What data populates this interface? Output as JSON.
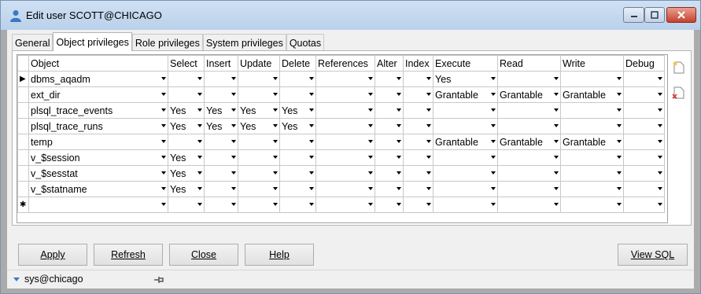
{
  "window": {
    "title": "Edit user SCOTT@CHICAGO",
    "controls": [
      "minimize",
      "maximize",
      "close"
    ]
  },
  "tabs": [
    {
      "label": "General",
      "active": false
    },
    {
      "label": "Object privileges",
      "active": true
    },
    {
      "label": "Role privileges",
      "active": false
    },
    {
      "label": "System privileges",
      "active": false
    },
    {
      "label": "Quotas",
      "active": false
    }
  ],
  "grid": {
    "columns": [
      "Object",
      "Select",
      "Insert",
      "Update",
      "Delete",
      "References",
      "Alter",
      "Index",
      "Execute",
      "Read",
      "Write",
      "Debug"
    ],
    "rows": [
      [
        "dbms_aqadm",
        "",
        "",
        "",
        "",
        "",
        "",
        "",
        "Yes",
        "",
        "",
        ""
      ],
      [
        "ext_dir",
        "",
        "",
        "",
        "",
        "",
        "",
        "",
        "Grantable",
        "Grantable",
        "Grantable",
        ""
      ],
      [
        "plsql_trace_events",
        "Yes",
        "Yes",
        "Yes",
        "Yes",
        "",
        "",
        "",
        "",
        "",
        "",
        ""
      ],
      [
        "plsql_trace_runs",
        "Yes",
        "Yes",
        "Yes",
        "Yes",
        "",
        "",
        "",
        "",
        "",
        "",
        ""
      ],
      [
        "temp",
        "",
        "",
        "",
        "",
        "",
        "",
        "",
        "Grantable",
        "Grantable",
        "Grantable",
        ""
      ],
      [
        "v_$session",
        "Yes",
        "",
        "",
        "",
        "",
        "",
        "",
        "",
        "",
        "",
        ""
      ],
      [
        "v_$sesstat",
        "Yes",
        "",
        "",
        "",
        "",
        "",
        "",
        "",
        "",
        "",
        ""
      ],
      [
        "v_$statname",
        "Yes",
        "",
        "",
        "",
        "",
        "",
        "",
        "",
        "",
        "",
        ""
      ],
      [
        "",
        "",
        "",
        "",
        "",
        "",
        "",
        "",
        "",
        "",
        "",
        ""
      ]
    ],
    "current_row_marker": "▶",
    "new_row_marker": "✱"
  },
  "side_icons": [
    "new-document-icon",
    "delete-document-icon"
  ],
  "buttons": {
    "apply": "Apply",
    "refresh": "Refresh",
    "close": "Close",
    "help": "Help",
    "view_sql": "View SQL"
  },
  "status": {
    "connection": "sys@chicago",
    "pin_icon": "pin-icon"
  },
  "colors": {
    "titlebar": "#c4d9ef",
    "close_button": "#c7412c"
  }
}
